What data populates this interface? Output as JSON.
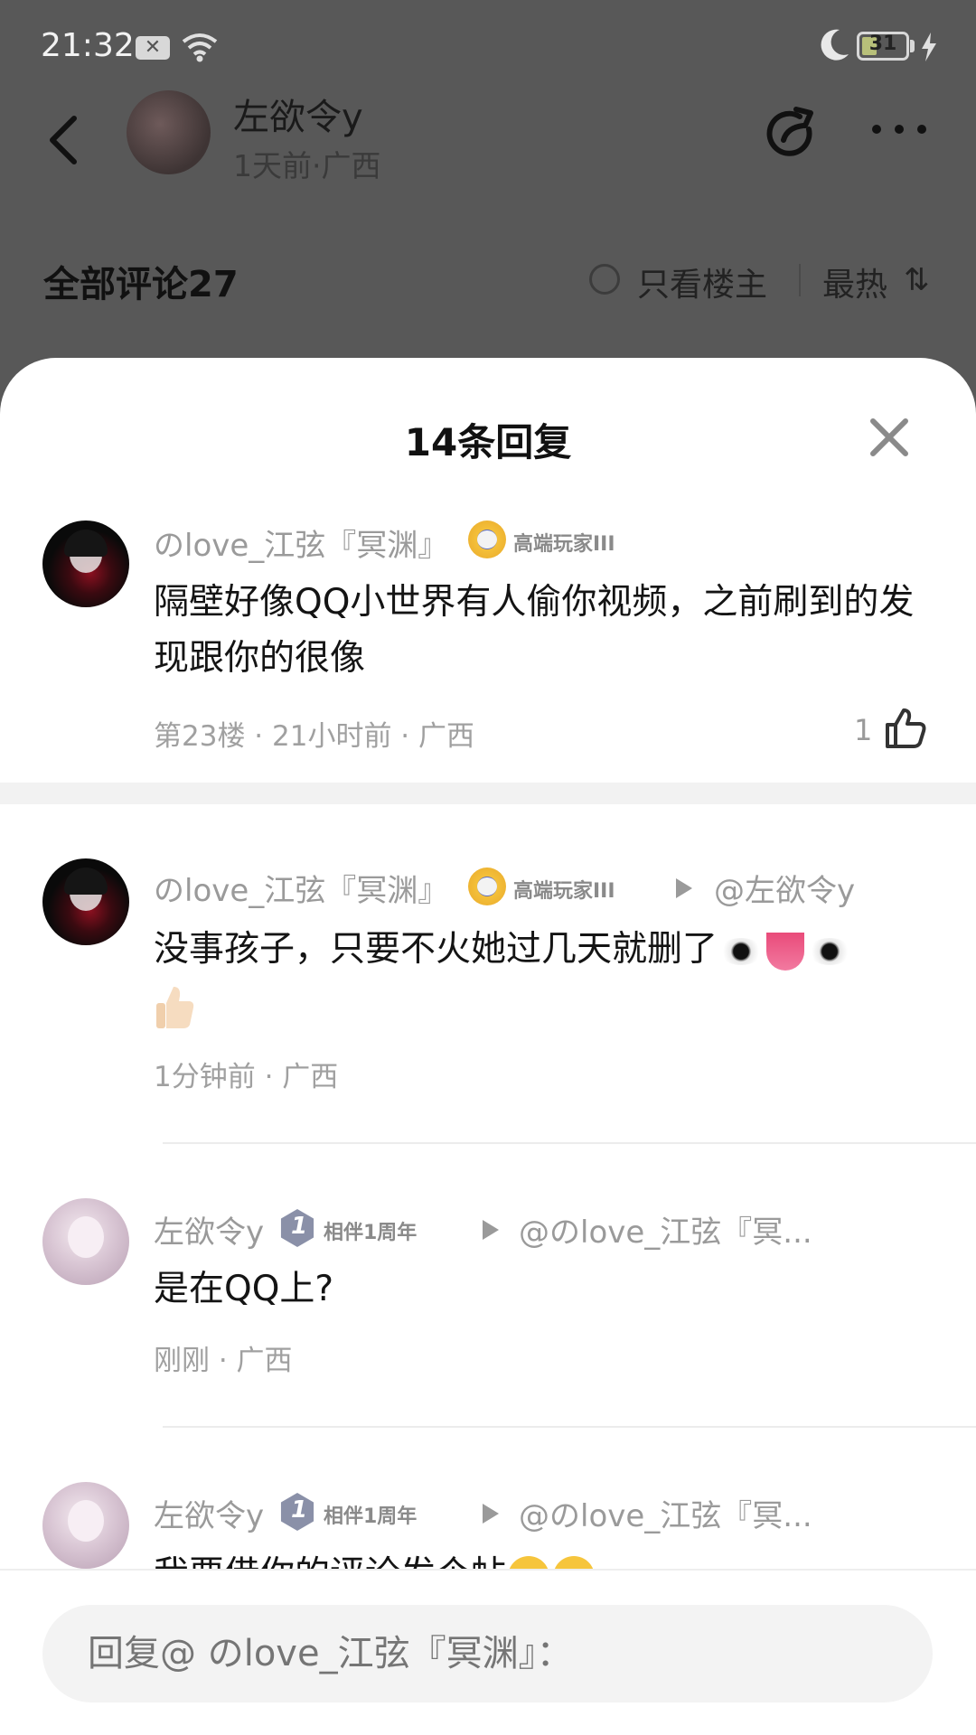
{
  "status_bar": {
    "time": "21:32",
    "battery_level": "31",
    "icons": [
      "sim-icon",
      "wifi-icon",
      "moon-icon",
      "battery-icon",
      "bolt-icon"
    ]
  },
  "post_header": {
    "author": "左欲令y",
    "meta": "1天前·广西"
  },
  "comments_bar": {
    "title": "全部评论27",
    "op_only": "只看楼主",
    "sort": "最热"
  },
  "reply_sheet": {
    "title": "14条回复",
    "parent_comment": {
      "user": "のlove_江弦『冥渊』",
      "badge": "高端玩家III",
      "text": "隔壁好像QQ小世界有人偷你视频，之前刷到的发现跟你的很像",
      "meta": "第23楼 · 21小时前 · 广西",
      "likes": "1"
    },
    "replies": [
      {
        "user": "のlove_江弦『冥渊』",
        "badge": "高端玩家III",
        "reply_to": "@左欲令y",
        "text": "没事孩子，只要不火她过几天就删了",
        "emojis": [
          "eye-emoji",
          "tongue-emoji",
          "eye-emoji",
          "thumbs-up-emoji"
        ],
        "meta": "1分钟前 · 广西"
      },
      {
        "user": "左欲令y",
        "badge": "相伴1周年",
        "reply_to": "@のlove_江弦『冥...",
        "text": "是在QQ上?",
        "meta": "刚刚 · 广西"
      },
      {
        "user": "左欲令y",
        "badge": "相伴1周年",
        "reply_to": "@のlove_江弦『冥...",
        "text": "我要借你的评论发个帖",
        "emojis": [
          "smile-emoji",
          "smile-emoji"
        ]
      }
    ]
  },
  "reply_input": {
    "placeholder": "回复@ のlove_江弦『冥渊』："
  },
  "colors": {
    "overlay": "#585858",
    "sheet": "#ffffff",
    "muted_text": "#9a9a9a",
    "body_text": "#141414"
  }
}
